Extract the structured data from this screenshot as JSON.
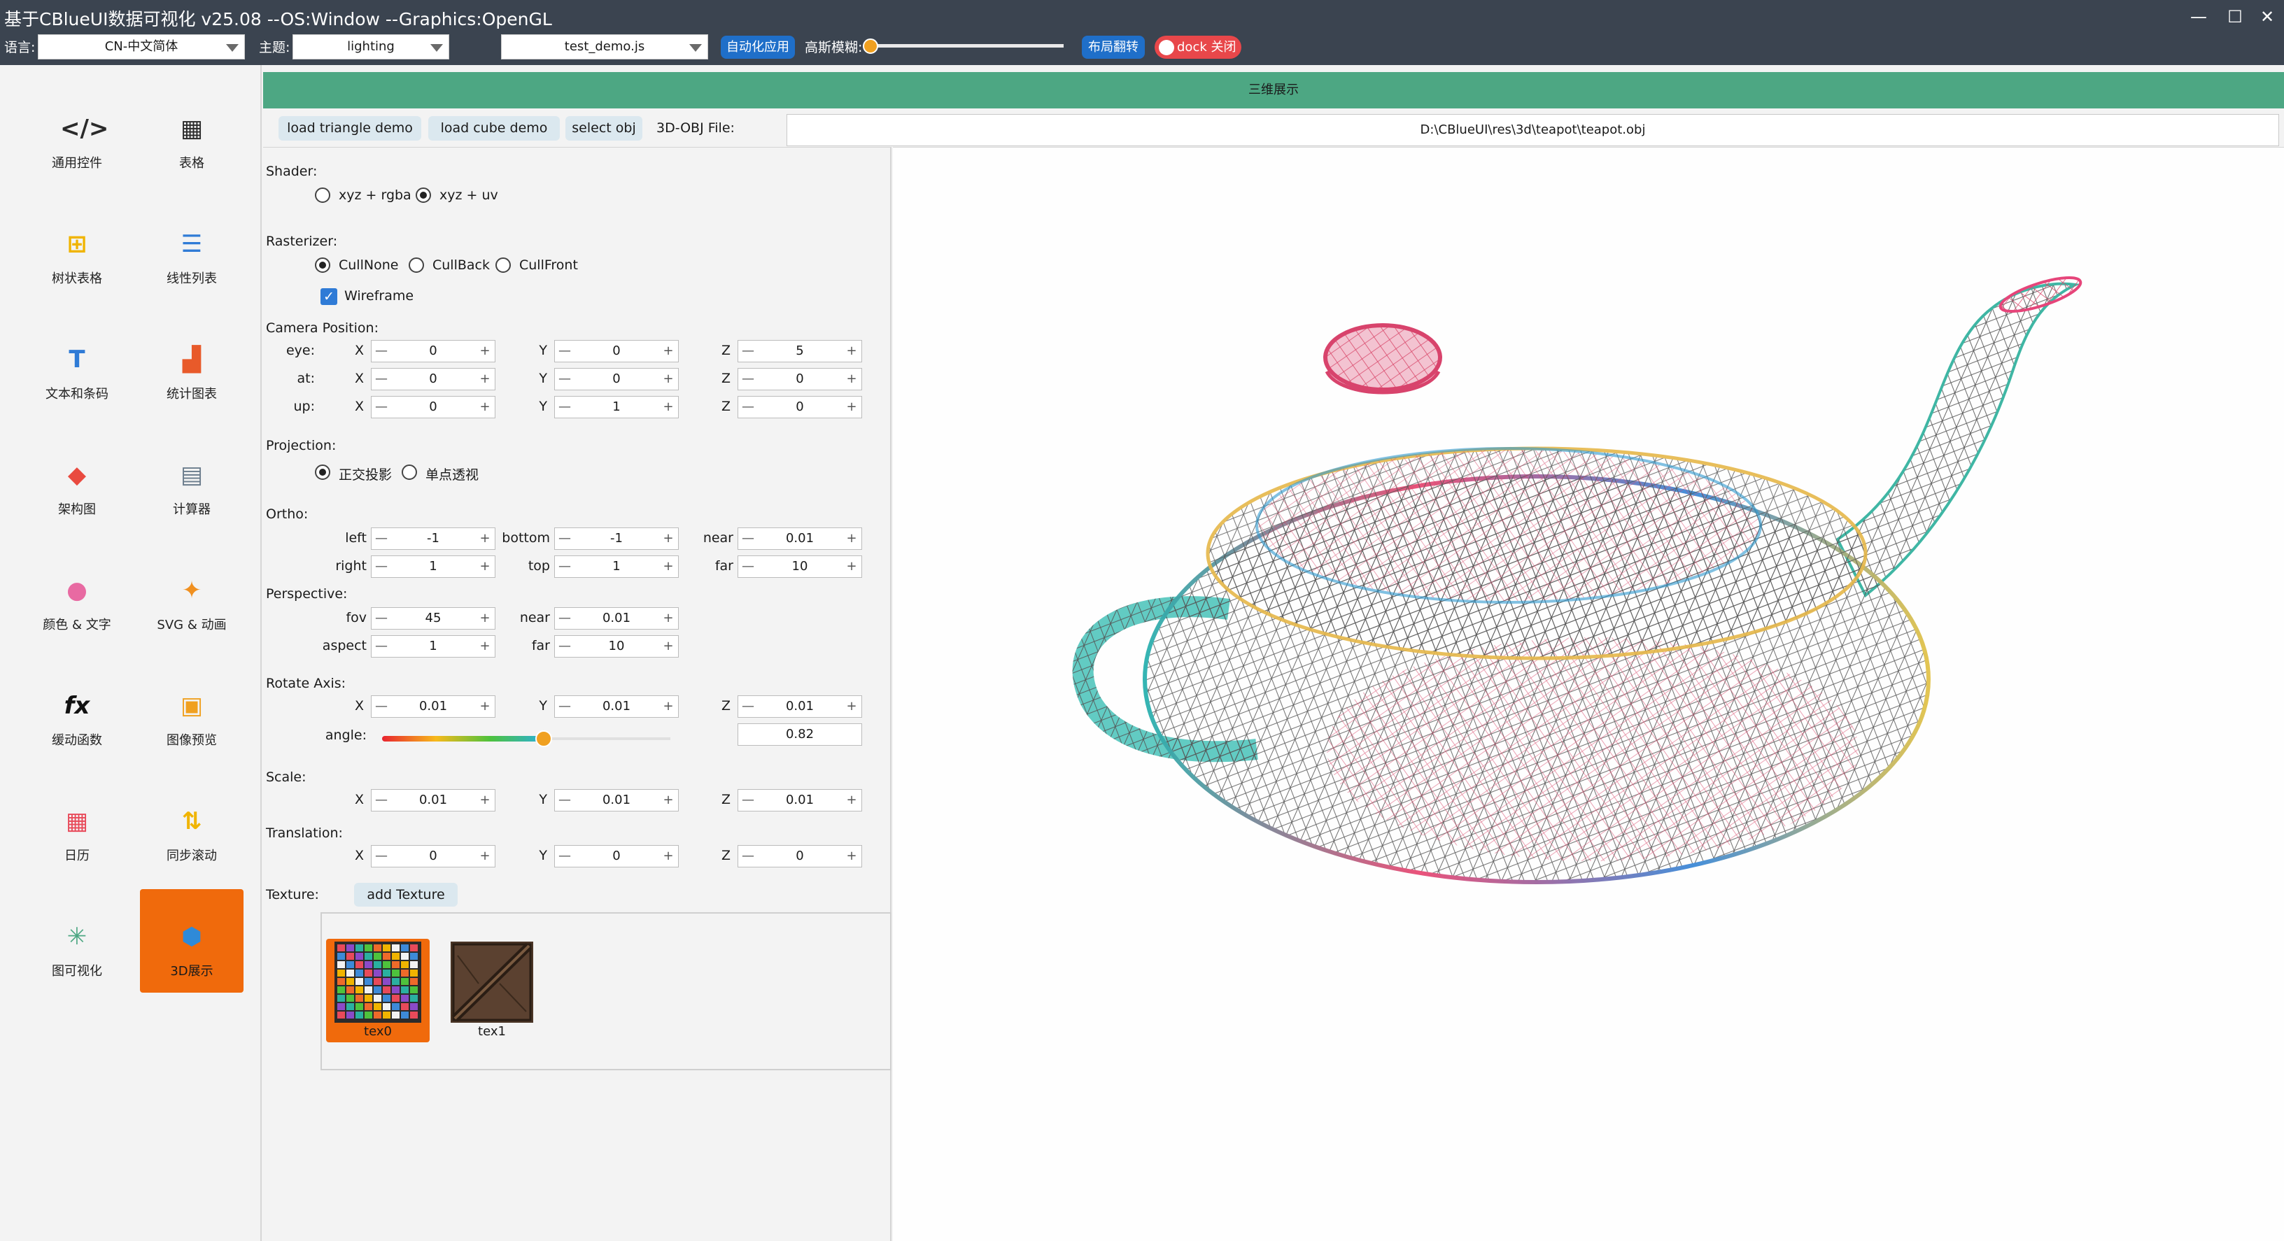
{
  "window": {
    "title": "基于CBlueUI数据可视化  v25.08 --OS:Window  --Graphics:OpenGL",
    "min_glyph": "—",
    "max_glyph": "☐",
    "close_glyph": "✕"
  },
  "toolbar": {
    "language_label": "语言:",
    "language_value": "CN-中文简体",
    "theme_label": "主题:",
    "theme_value": "lighting",
    "script_value": "test_demo.js",
    "auto_apply_label": "自动化应用",
    "blur_label": "高斯模糊:",
    "blur_level": 0.0,
    "layout_flip_label": "布局翻转",
    "dock_label": "dock 关闭",
    "accent_color": "#1f6fc9",
    "dock_color": "#e8474a",
    "slider_color": "#f0a020"
  },
  "sidebar": {
    "items": [
      {
        "label": "通用控件",
        "icon": "code-window-icon"
      },
      {
        "label": "表格",
        "icon": "calendar-grid-icon"
      },
      {
        "label": "树状表格",
        "icon": "tree-table-icon"
      },
      {
        "label": "线性列表",
        "icon": "list-icon"
      },
      {
        "label": "文本和条码",
        "icon": "text-icon"
      },
      {
        "label": "统计图表",
        "icon": "bar-chart-icon"
      },
      {
        "label": "架构图",
        "icon": "layers-icon"
      },
      {
        "label": "计算器",
        "icon": "calculator-icon"
      },
      {
        "label": "颜色 & 文字",
        "icon": "color-wheel-icon"
      },
      {
        "label": "SVG & 动画",
        "icon": "running-man-icon"
      },
      {
        "label": "缓动函数",
        "icon": "fx-icon"
      },
      {
        "label": "图像预览",
        "icon": "image-icon"
      },
      {
        "label": "日历",
        "icon": "calendar-icon"
      },
      {
        "label": "同步滚动",
        "icon": "sync-scroll-icon"
      },
      {
        "label": "图可视化",
        "icon": "graph-icon"
      },
      {
        "label": "3D展示",
        "icon": "cube-icon"
      }
    ],
    "active_index": 15,
    "active_color": "#f06a0c"
  },
  "header": {
    "title": "三维展示",
    "color": "#4da783"
  },
  "actions": {
    "load_triangle": "load triangle demo",
    "load_cube": "load cube demo",
    "select_obj": "select obj",
    "obj_label": "3D-OBJ File:",
    "obj_path": "D:\\CBlueUI\\res\\3d\\teapot\\teapot.obj"
  },
  "shader": {
    "label": "Shader:",
    "options": [
      "xyz + rgba",
      "xyz + uv"
    ],
    "selected": 1
  },
  "rasterizer": {
    "label": "Rasterizer:",
    "options": [
      "CullNone",
      "CullBack",
      "CullFront"
    ],
    "selected": 0,
    "wireframe_label": "Wireframe",
    "wireframe_checked": true,
    "check_glyph": "✓"
  },
  "axes": {
    "x": "X",
    "y": "Y",
    "z": "Z",
    "minus": "—",
    "plus": "+"
  },
  "camera": {
    "label": "Camera Position:",
    "rows": [
      {
        "name": "eye:",
        "x": "0",
        "y": "0",
        "z": "5"
      },
      {
        "name": "at:",
        "x": "0",
        "y": "0",
        "z": "0"
      },
      {
        "name": "up:",
        "x": "0",
        "y": "1",
        "z": "0"
      }
    ]
  },
  "projection": {
    "label": "Projection:",
    "options": [
      "正交投影",
      "单点透视"
    ],
    "selected": 0
  },
  "ortho": {
    "label": "Ortho:",
    "left_label": "left",
    "left": "-1",
    "bottom_label": "bottom",
    "bottom": "-1",
    "near_label": "near",
    "near": "0.01",
    "right_label": "right",
    "right": "1",
    "top_label": "top",
    "top": "1",
    "far_label": "far",
    "far": "10"
  },
  "perspective": {
    "label": "Perspective:",
    "fov_label": "fov",
    "fov": "45",
    "near_label": "near",
    "near": "0.01",
    "aspect_label": "aspect",
    "aspect": "1",
    "far_label": "far",
    "far": "10"
  },
  "rotate": {
    "label": "Rotate Axis:",
    "x": "0.01",
    "y": "0.01",
    "z": "0.01",
    "angle_label": "angle:",
    "angle": "0.82",
    "angle_level": 0.56
  },
  "scale": {
    "label": "Scale:",
    "x": "0.01",
    "y": "0.01",
    "z": "0.01"
  },
  "translation": {
    "label": "Translation:",
    "x": "0",
    "y": "0",
    "z": "0"
  },
  "texture": {
    "label": "Texture:",
    "add_label": "add Texture",
    "items": [
      {
        "name": "tex0"
      },
      {
        "name": "tex1"
      }
    ],
    "selected": 0
  }
}
